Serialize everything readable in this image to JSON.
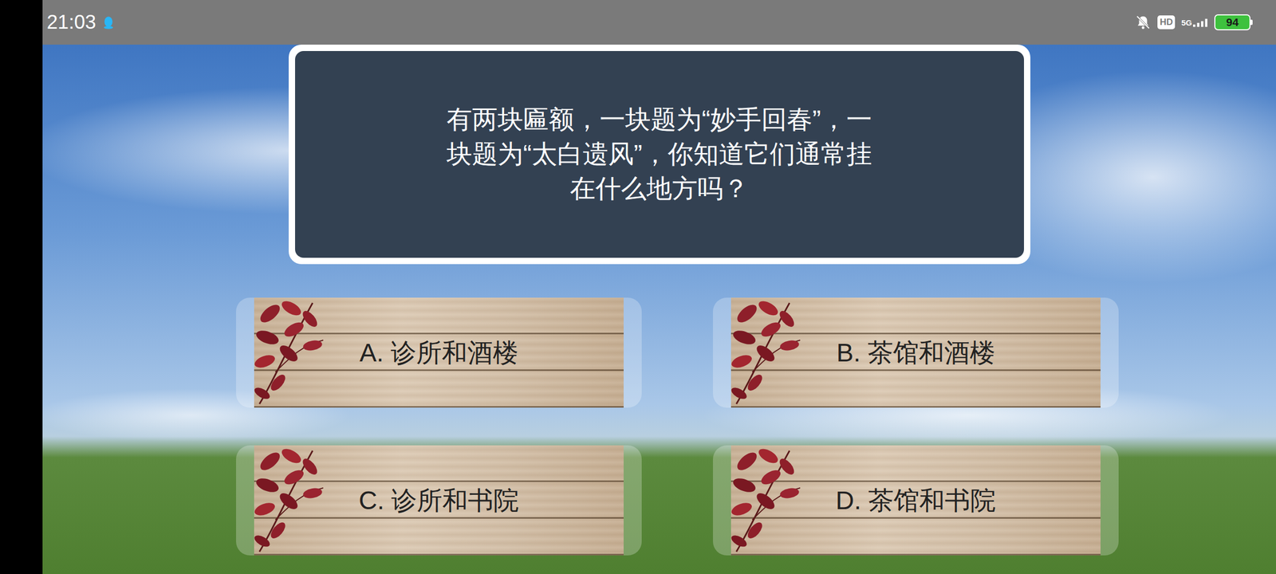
{
  "status_bar": {
    "time": "21:03",
    "network": "5G",
    "hd": "HD",
    "battery": "94"
  },
  "question": {
    "text": "有两块匾额，一块题为“妙手回春”，一块题为“太白遗风”，你知道它们通常挂在什么地方吗？"
  },
  "options": [
    {
      "label": "A. 诊所和酒楼"
    },
    {
      "label": "B. 茶馆和酒楼"
    },
    {
      "label": "C. 诊所和书院"
    },
    {
      "label": "D. 茶馆和书院"
    }
  ]
}
